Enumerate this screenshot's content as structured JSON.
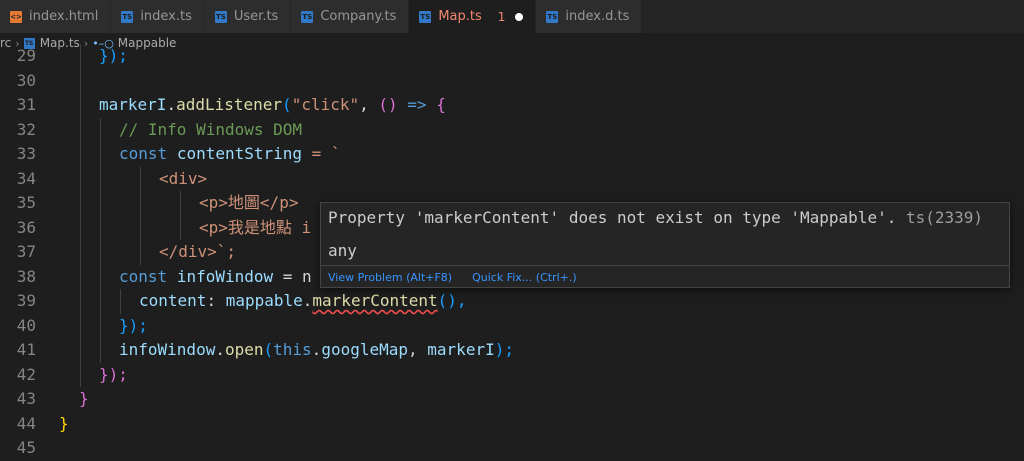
{
  "tabs": [
    {
      "label": "index.html",
      "icon": "html-file-icon"
    },
    {
      "label": "index.ts",
      "icon": "ts-file-icon"
    },
    {
      "label": "User.ts",
      "icon": "ts-file-icon"
    },
    {
      "label": "Company.ts",
      "icon": "ts-file-icon"
    },
    {
      "label": "Map.ts",
      "icon": "ts-file-icon",
      "active": true,
      "problems": "1",
      "modified": true
    },
    {
      "label": "index.d.ts",
      "icon": "ts-file-icon"
    }
  ],
  "breadcrumb": {
    "root": "rc",
    "file": "Map.ts",
    "symbol": "Mappable"
  },
  "line_numbers": [
    "29",
    "30",
    "31",
    "32",
    "33",
    "34",
    "35",
    "36",
    "37",
    "38",
    "39",
    "40",
    "41",
    "42",
    "43",
    "44",
    "45"
  ],
  "code": {
    "l29": "});",
    "l31_obj": "markerI",
    "l31_method": "addListener",
    "l31_str": "\"click\"",
    "l31_arrow": "() => ",
    "l32": "// Info Windows DOM",
    "l33_kw": "const",
    "l33_var": "contentString",
    "l33_tail": " = `",
    "l34": "<div>",
    "l35_open": "<p>",
    "l35_text": "地圖",
    "l35_close": "</p>",
    "l36_open": "<p>",
    "l36_text": "我是地點 i",
    "l37": "</div>`;",
    "l38_kw": "const",
    "l38_var": "infoWindow",
    "l38_tail": " = n",
    "l39_prop": "content",
    "l39_obj": "mappable",
    "l39_method": "markerContent",
    "l39_tail": "(),",
    "l40": "});",
    "l41_obj": "infoWindow",
    "l41_method": "open",
    "l41_this": "this",
    "l41_prop": "googleMap",
    "l41_arg": "markerI",
    "l41_tail": ");",
    "l42": "});",
    "l43": "}",
    "l44": "}"
  },
  "hover": {
    "message": "Property 'markerContent' does not exist on type 'Mappable'.",
    "code": "ts(2339)",
    "type": "any",
    "view_problem": "View Problem (Alt+F8)",
    "quick_fix": "Quick Fix... (Ctrl+.)"
  },
  "colors": {
    "error": "#f14c4c",
    "keyword": "#569cd6",
    "string": "#ce9178",
    "comment": "#6a9955",
    "link": "#3794ff"
  }
}
